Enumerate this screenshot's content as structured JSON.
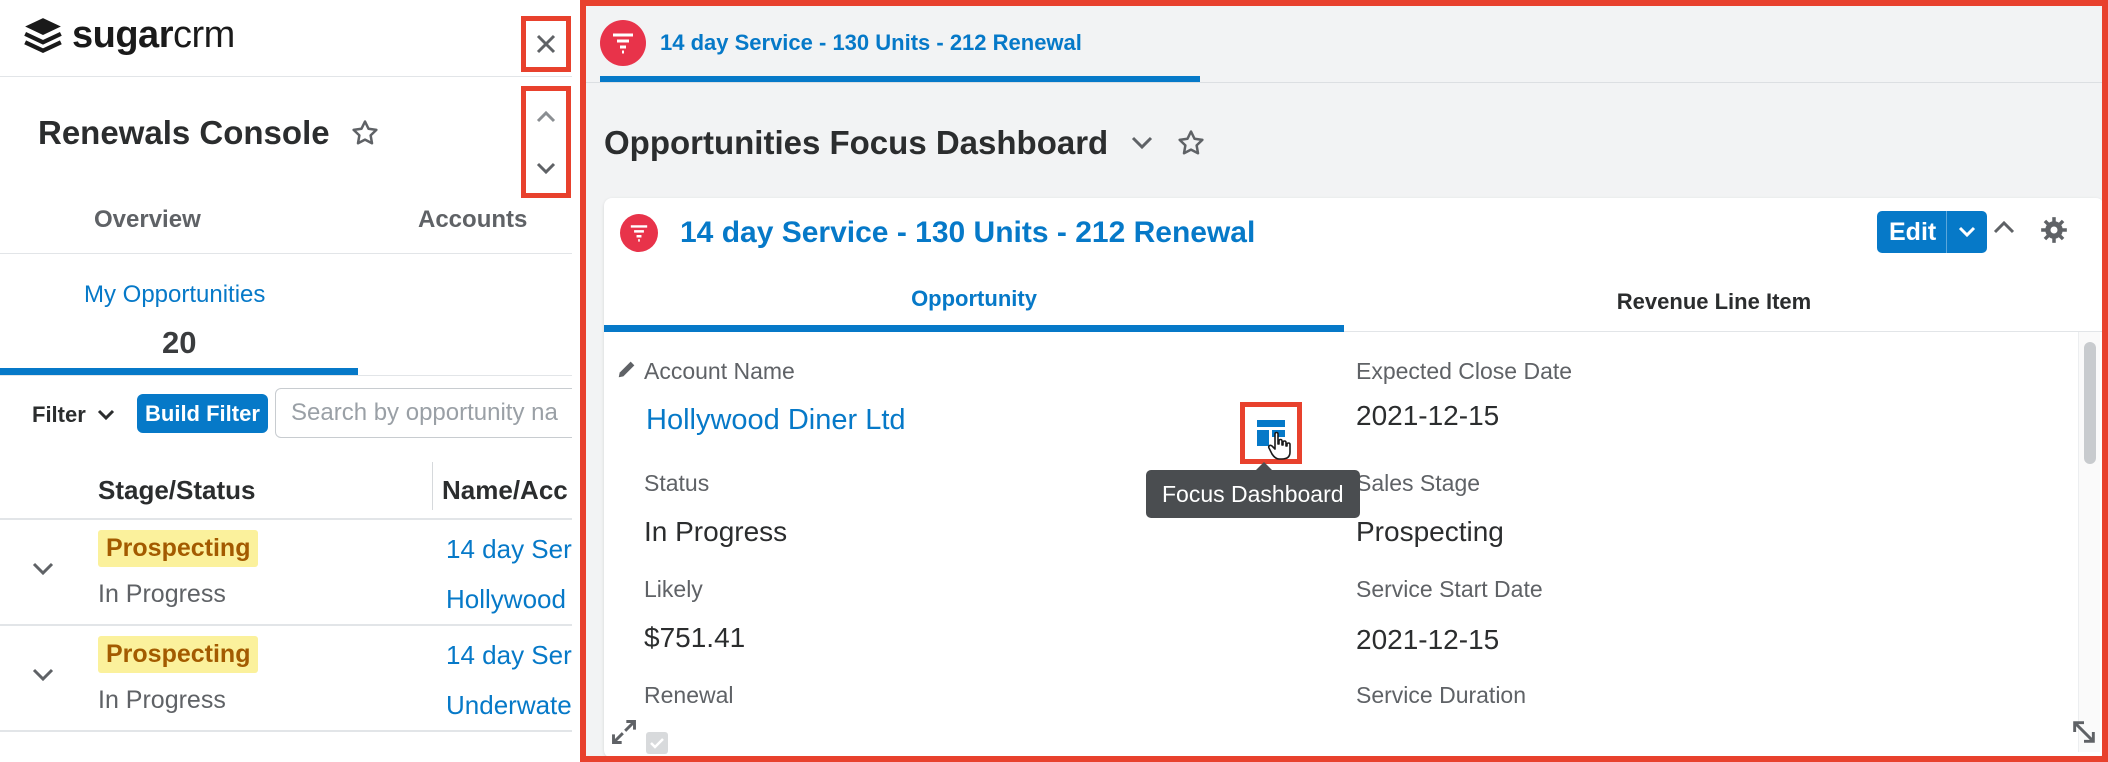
{
  "app": {
    "logo_brand": "sugar",
    "logo_suffix": "crm"
  },
  "left_panel": {
    "console_title": "Renewals Console",
    "tabs": [
      {
        "label": "Overview"
      },
      {
        "label": "Accounts"
      }
    ],
    "section_title": "My Opportunities",
    "section_count": "20",
    "filter_label": "Filter",
    "build_filter_label": "Build Filter",
    "search_placeholder": "Search by opportunity na",
    "columns": [
      {
        "label": "Stage/Status"
      },
      {
        "label": "Name/Acc"
      }
    ],
    "rows": [
      {
        "stage": "Prospecting",
        "status": "In Progress",
        "name": "14 day Ser",
        "account": "Hollywood"
      },
      {
        "stage": "Prospecting",
        "status": "In Progress",
        "name": "14 day Ser",
        "account": "Underwate"
      }
    ]
  },
  "right_panel": {
    "top_tab_label": "14 day Service - 130 Units - 212 Renewal",
    "dashboard_title": "Opportunities Focus Dashboard",
    "dashlet": {
      "title": "14 day Service - 130 Units - 212 Renewal",
      "edit_label": "Edit",
      "tabs": [
        {
          "label": "Opportunity",
          "active": true
        },
        {
          "label": "Revenue Line Item",
          "active": false
        }
      ],
      "fields_left": [
        {
          "label": "Account Name",
          "value": "Hollywood Diner Ltd"
        },
        {
          "label": "Status",
          "value": "In Progress"
        },
        {
          "label": "Likely",
          "value": "$751.41"
        },
        {
          "label": "Renewal",
          "value": ""
        }
      ],
      "fields_right": [
        {
          "label": "Expected Close Date",
          "value": "2021-12-15"
        },
        {
          "label": "Sales Stage",
          "value": "Prospecting"
        },
        {
          "label": "Service Start Date",
          "value": "2021-12-15"
        },
        {
          "label": "Service Duration",
          "value": ""
        }
      ],
      "tooltip": "Focus Dashboard"
    }
  },
  "colors": {
    "accent": "#0679c8",
    "highlight": "#e8412d",
    "badge_bg": "#fbf19c",
    "badge_text": "#a35b00",
    "record_icon": "#e8334a"
  }
}
